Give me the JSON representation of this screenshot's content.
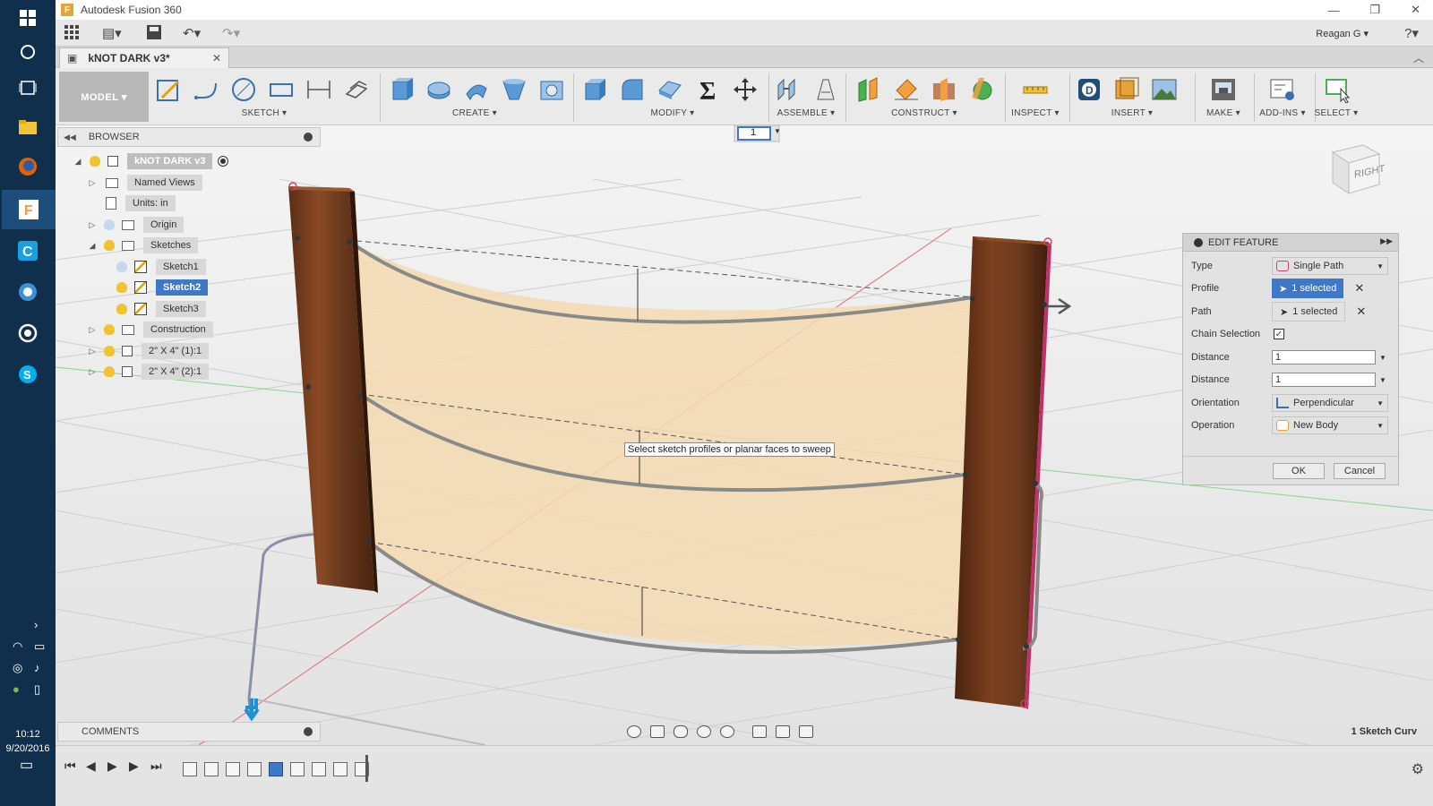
{
  "window": {
    "title": "Autodesk Fusion 360",
    "app_icon": "F"
  },
  "quickbar": {
    "user": "Reagan G ▾",
    "help_icon": "?"
  },
  "tab": {
    "name": "kNOT DARK v3*"
  },
  "ribbon": {
    "workspace": "MODEL ▾",
    "groups": [
      {
        "label": "SKETCH ▾"
      },
      {
        "label": "CREATE ▾"
      },
      {
        "label": "MODIFY ▾"
      },
      {
        "label": "ASSEMBLE ▾"
      },
      {
        "label": "CONSTRUCT ▾"
      },
      {
        "label": "INSPECT ▾"
      },
      {
        "label": "INSERT ▾"
      },
      {
        "label": "MAKE ▾"
      },
      {
        "label": "ADD-INS ▾"
      },
      {
        "label": "SELECT ▾"
      }
    ]
  },
  "browser": {
    "title": "BROWSER",
    "items": [
      {
        "label": "kNOT DARK v3"
      },
      {
        "label": "Named Views"
      },
      {
        "label": "Units: in"
      },
      {
        "label": "Origin"
      },
      {
        "label": "Sketches"
      },
      {
        "label": "Sketch1"
      },
      {
        "label": "Sketch2"
      },
      {
        "label": "Sketch3"
      },
      {
        "label": "Construction"
      },
      {
        "label": "2\" X 4\" (1):1"
      },
      {
        "label": "2\" X 4\" (2):1"
      }
    ]
  },
  "canvas": {
    "tooltip": "Select sketch profiles or planar faces to sweep",
    "counter": "1",
    "viewcube_face": "RIGHT"
  },
  "edit_feature": {
    "title": "EDIT FEATURE",
    "rows": {
      "type_label": "Type",
      "type_value": "Single Path",
      "profile_label": "Profile",
      "profile_value": "1 selected",
      "path_label": "Path",
      "path_value": "1 selected",
      "chain_label": "Chain Selection",
      "chain_checked": true,
      "distance1_label": "Distance",
      "distance1_value": "1",
      "distance2_label": "Distance",
      "distance2_value": "1",
      "orientation_label": "Orientation",
      "orientation_value": "Perpendicular",
      "operation_label": "Operation",
      "operation_value": "New Body"
    },
    "ok_label": "OK",
    "cancel_label": "Cancel"
  },
  "comments": {
    "title": "COMMENTS"
  },
  "status": {
    "text": "1 Sketch Curv"
  },
  "taskbar": {
    "time": "10:12",
    "date": "9/20/2016"
  },
  "colors": {
    "accent": "#3f78c7",
    "wood": "#6b3a1f",
    "profile_fill": "#f5d9b0",
    "taskbar": "#0f2f4c"
  }
}
